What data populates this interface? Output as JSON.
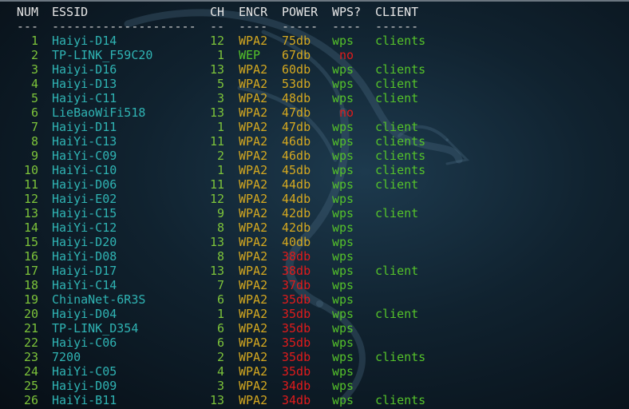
{
  "header": {
    "num": "NUM",
    "essid": "ESSID",
    "ch": "CH",
    "encr": "ENCR",
    "power": "POWER",
    "wps": "WPS?",
    "client": "CLIENT"
  },
  "separator": {
    "num": "---",
    "essid": "--------------------",
    "ch": "--",
    "encr": "----",
    "power": "-----",
    "wps": "----",
    "client": "------"
  },
  "colors": {
    "green": "#55c22a",
    "yellow": "#d4a820",
    "red": "#e01b1b",
    "cyan": "#2fb3b3"
  },
  "rows": [
    {
      "num": "1",
      "essid": "Haiyi-D14",
      "ch": "12",
      "encr": "WPA2",
      "encr_color": "y",
      "power": "75db",
      "power_color": "y",
      "wps": "wps",
      "wps_color": "g",
      "client": "clients"
    },
    {
      "num": "2",
      "essid": "TP-LINK_F59C20",
      "ch": "1",
      "encr": "WEP",
      "encr_color": "g",
      "power": "67db",
      "power_color": "y",
      "wps": " no",
      "wps_color": "r",
      "client": ""
    },
    {
      "num": "3",
      "essid": "Haiyi-D16",
      "ch": "13",
      "encr": "WPA2",
      "encr_color": "y",
      "power": "60db",
      "power_color": "y",
      "wps": "wps",
      "wps_color": "g",
      "client": "clients"
    },
    {
      "num": "4",
      "essid": "Haiyi-D13",
      "ch": "5",
      "encr": "WPA2",
      "encr_color": "y",
      "power": "53db",
      "power_color": "y",
      "wps": "wps",
      "wps_color": "g",
      "client": "client"
    },
    {
      "num": "5",
      "essid": "Haiyi-C11",
      "ch": "3",
      "encr": "WPA2",
      "encr_color": "y",
      "power": "48db",
      "power_color": "y",
      "wps": "wps",
      "wps_color": "g",
      "client": "client"
    },
    {
      "num": "6",
      "essid": "LieBaoWiFi518",
      "ch": "13",
      "encr": "WPA2",
      "encr_color": "y",
      "power": "47db",
      "power_color": "y",
      "wps": " no",
      "wps_color": "r",
      "client": ""
    },
    {
      "num": "7",
      "essid": "Haiyi-D11",
      "ch": "1",
      "encr": "WPA2",
      "encr_color": "y",
      "power": "47db",
      "power_color": "y",
      "wps": "wps",
      "wps_color": "g",
      "client": "client"
    },
    {
      "num": "8",
      "essid": "HaiYi-C13",
      "ch": "11",
      "encr": "WPA2",
      "encr_color": "y",
      "power": "46db",
      "power_color": "y",
      "wps": "wps",
      "wps_color": "g",
      "client": "clients"
    },
    {
      "num": "9",
      "essid": "HaiYi-C09",
      "ch": "2",
      "encr": "WPA2",
      "encr_color": "y",
      "power": "46db",
      "power_color": "y",
      "wps": "wps",
      "wps_color": "g",
      "client": "clients"
    },
    {
      "num": "10",
      "essid": "HaiYi-C10",
      "ch": "1",
      "encr": "WPA2",
      "encr_color": "y",
      "power": "45db",
      "power_color": "y",
      "wps": "wps",
      "wps_color": "g",
      "client": "clients"
    },
    {
      "num": "11",
      "essid": "Haiyi-D06",
      "ch": "11",
      "encr": "WPA2",
      "encr_color": "y",
      "power": "44db",
      "power_color": "y",
      "wps": "wps",
      "wps_color": "g",
      "client": "client"
    },
    {
      "num": "12",
      "essid": "Haiyi-E02",
      "ch": "12",
      "encr": "WPA2",
      "encr_color": "y",
      "power": "44db",
      "power_color": "y",
      "wps": "wps",
      "wps_color": "g",
      "client": ""
    },
    {
      "num": "13",
      "essid": "Haiyi-C15",
      "ch": "9",
      "encr": "WPA2",
      "encr_color": "y",
      "power": "42db",
      "power_color": "y",
      "wps": "wps",
      "wps_color": "g",
      "client": "client"
    },
    {
      "num": "14",
      "essid": "HaiYi-C12",
      "ch": "8",
      "encr": "WPA2",
      "encr_color": "y",
      "power": "42db",
      "power_color": "y",
      "wps": "wps",
      "wps_color": "g",
      "client": ""
    },
    {
      "num": "15",
      "essid": "Haiyi-D20",
      "ch": "13",
      "encr": "WPA2",
      "encr_color": "y",
      "power": "40db",
      "power_color": "y",
      "wps": "wps",
      "wps_color": "g",
      "client": ""
    },
    {
      "num": "16",
      "essid": "HaiYi-D08",
      "ch": "8",
      "encr": "WPA2",
      "encr_color": "y",
      "power": "38db",
      "power_color": "r",
      "wps": "wps",
      "wps_color": "g",
      "client": ""
    },
    {
      "num": "17",
      "essid": "Haiyi-D17",
      "ch": "13",
      "encr": "WPA2",
      "encr_color": "y",
      "power": "38db",
      "power_color": "r",
      "wps": "wps",
      "wps_color": "g",
      "client": "client"
    },
    {
      "num": "18",
      "essid": "HaiYi-C14",
      "ch": "7",
      "encr": "WPA2",
      "encr_color": "y",
      "power": "37db",
      "power_color": "r",
      "wps": "wps",
      "wps_color": "g",
      "client": ""
    },
    {
      "num": "19",
      "essid": "ChinaNet-6R3S",
      "ch": "6",
      "encr": "WPA2",
      "encr_color": "y",
      "power": "35db",
      "power_color": "r",
      "wps": "wps",
      "wps_color": "g",
      "client": ""
    },
    {
      "num": "20",
      "essid": "Haiyi-D04",
      "ch": "1",
      "encr": "WPA2",
      "encr_color": "y",
      "power": "35db",
      "power_color": "r",
      "wps": "wps",
      "wps_color": "g",
      "client": "client"
    },
    {
      "num": "21",
      "essid": "TP-LINK_D354",
      "ch": "6",
      "encr": "WPA2",
      "encr_color": "y",
      "power": "35db",
      "power_color": "r",
      "wps": "wps",
      "wps_color": "g",
      "client": ""
    },
    {
      "num": "22",
      "essid": "Haiyi-C06",
      "ch": "6",
      "encr": "WPA2",
      "encr_color": "y",
      "power": "35db",
      "power_color": "r",
      "wps": "wps",
      "wps_color": "g",
      "client": ""
    },
    {
      "num": "23",
      "essid": "7200",
      "ch": "2",
      "encr": "WPA2",
      "encr_color": "y",
      "power": "35db",
      "power_color": "r",
      "wps": "wps",
      "wps_color": "g",
      "client": "clients"
    },
    {
      "num": "24",
      "essid": "HaiYi-C05",
      "ch": "4",
      "encr": "WPA2",
      "encr_color": "y",
      "power": "35db",
      "power_color": "r",
      "wps": "wps",
      "wps_color": "g",
      "client": ""
    },
    {
      "num": "25",
      "essid": "Haiyi-D09",
      "ch": "3",
      "encr": "WPA2",
      "encr_color": "y",
      "power": "34db",
      "power_color": "r",
      "wps": "wps",
      "wps_color": "g",
      "client": ""
    },
    {
      "num": "26",
      "essid": "HaiYi-B11",
      "ch": "13",
      "encr": "WPA2",
      "encr_color": "y",
      "power": "34db",
      "power_color": "r",
      "wps": "wps",
      "wps_color": "g",
      "client": "clients"
    }
  ]
}
